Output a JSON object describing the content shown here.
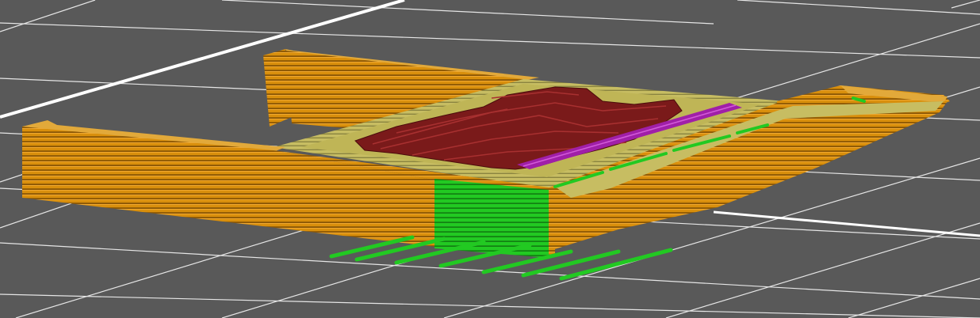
{
  "viewport": {
    "background": "#595959",
    "grid_line": "#e8e8e8",
    "grid_line_major": "#ffffff"
  },
  "preview": {
    "features": [
      {
        "id": "external-perimeter",
        "color": "#d98f0c"
      },
      {
        "id": "perimeter",
        "color": "#b8ad52"
      },
      {
        "id": "solid-infill",
        "color": "#7a1a1a"
      },
      {
        "id": "internal-infill",
        "color": "#a01fa8"
      },
      {
        "id": "support-material",
        "color": "#1fc21f"
      }
    ]
  }
}
